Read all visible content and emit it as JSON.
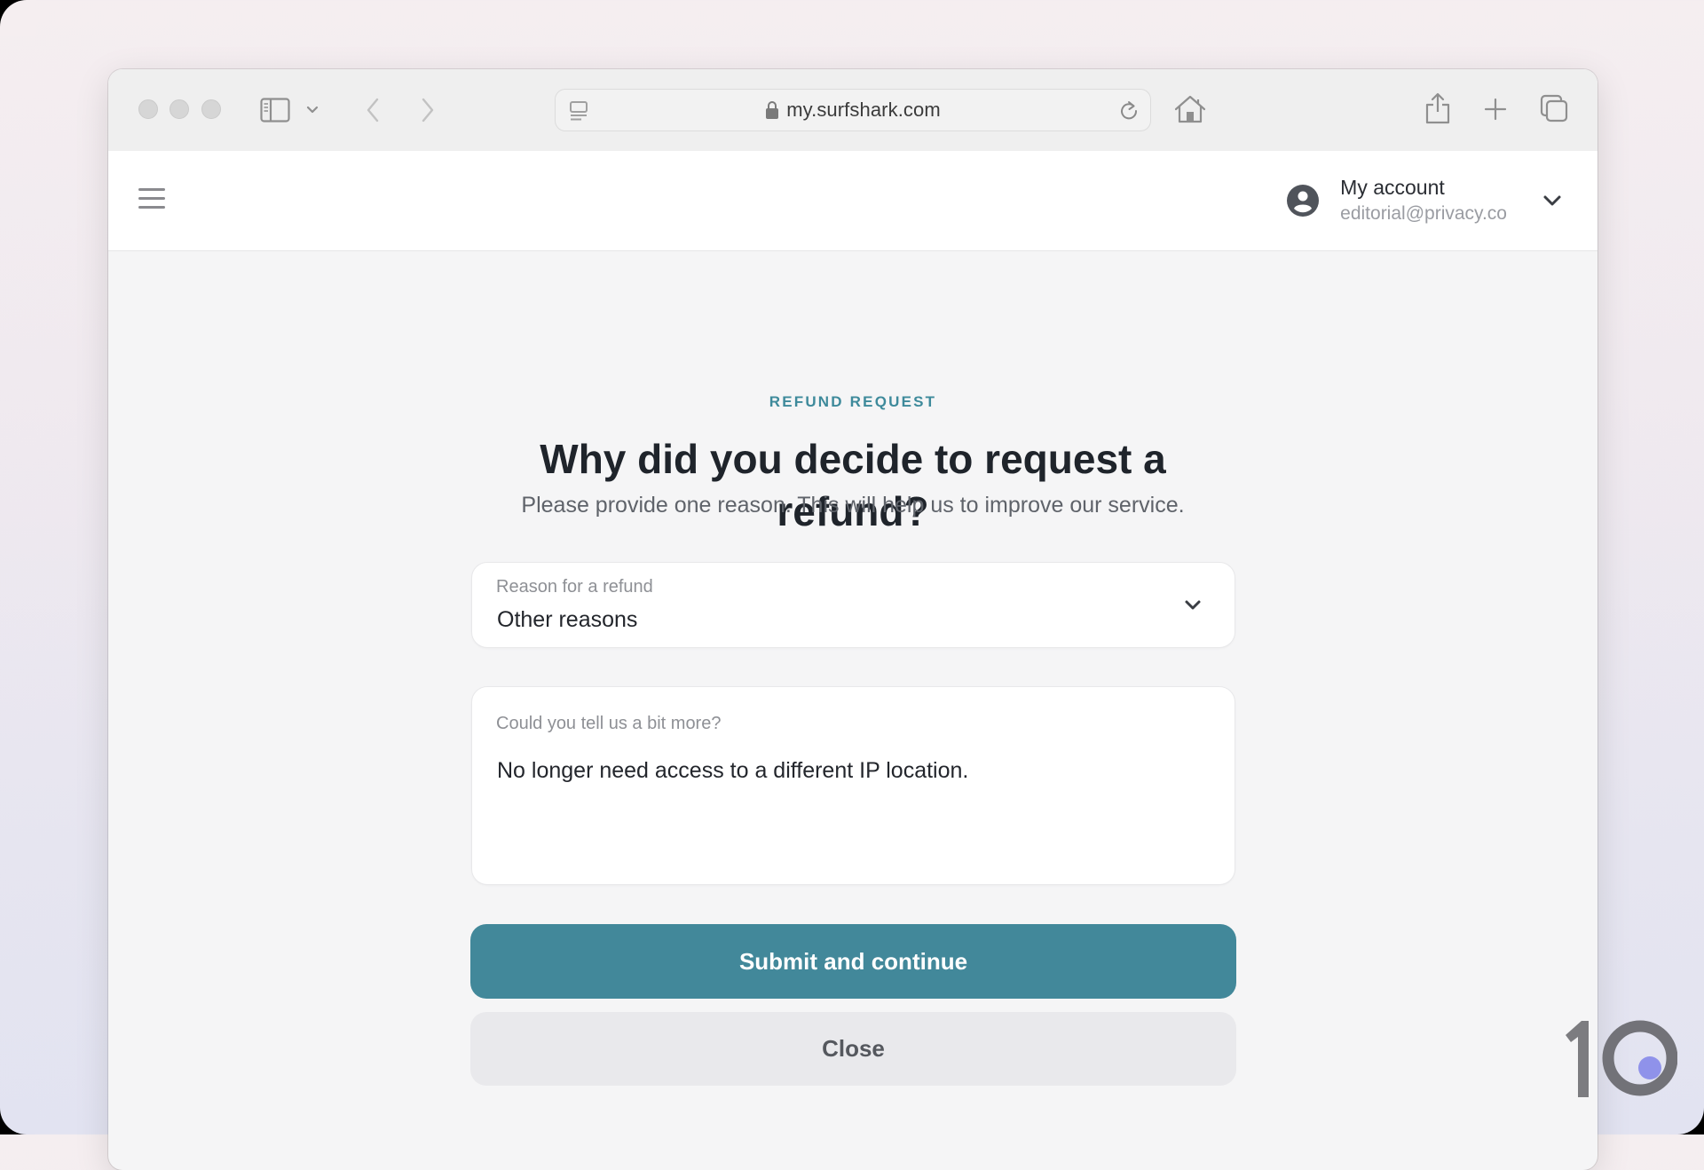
{
  "browser": {
    "url": "my.surfshark.com",
    "icons": {
      "traffic_lights": [
        "close-dot",
        "minimize-dot",
        "zoom-dot"
      ],
      "sidebar_toggle": "sidebar-icon",
      "sidebar_menu": "chevron-down-icon",
      "back": "chevron-left-icon",
      "forward": "chevron-right-icon",
      "reader": "reader-icon",
      "lock": "lock-icon",
      "reload": "reload-icon",
      "home": "home-icon",
      "share": "share-icon",
      "new_tab": "plus-icon",
      "tabs_overview": "tabs-icon"
    }
  },
  "header": {
    "menu_icon": "hamburger-icon",
    "account": {
      "title": "My account",
      "email": "editorial@privacy.co",
      "avatar_icon": "user-circle-icon",
      "dropdown_icon": "chevron-down-icon"
    }
  },
  "form": {
    "eyebrow": "REFUND REQUEST",
    "title": "Why did you decide to request a refund?",
    "subtitle": "Please provide one reason. This will help us to improve our service.",
    "reason_select": {
      "label": "Reason for a refund",
      "value": "Other reasons"
    },
    "details_textarea": {
      "label": "Could you tell us a bit more?",
      "value": "No longer need access to a different IP location."
    },
    "submit_label": "Submit and continue",
    "close_label": "Close"
  },
  "watermark": {
    "text": "10"
  },
  "colors": {
    "accent": "#42889a",
    "eyebrow": "#3e8a9b",
    "heading": "#1f242b",
    "secondary_button": "#e9e9ec",
    "watermark_dot": "#8f92ea"
  }
}
